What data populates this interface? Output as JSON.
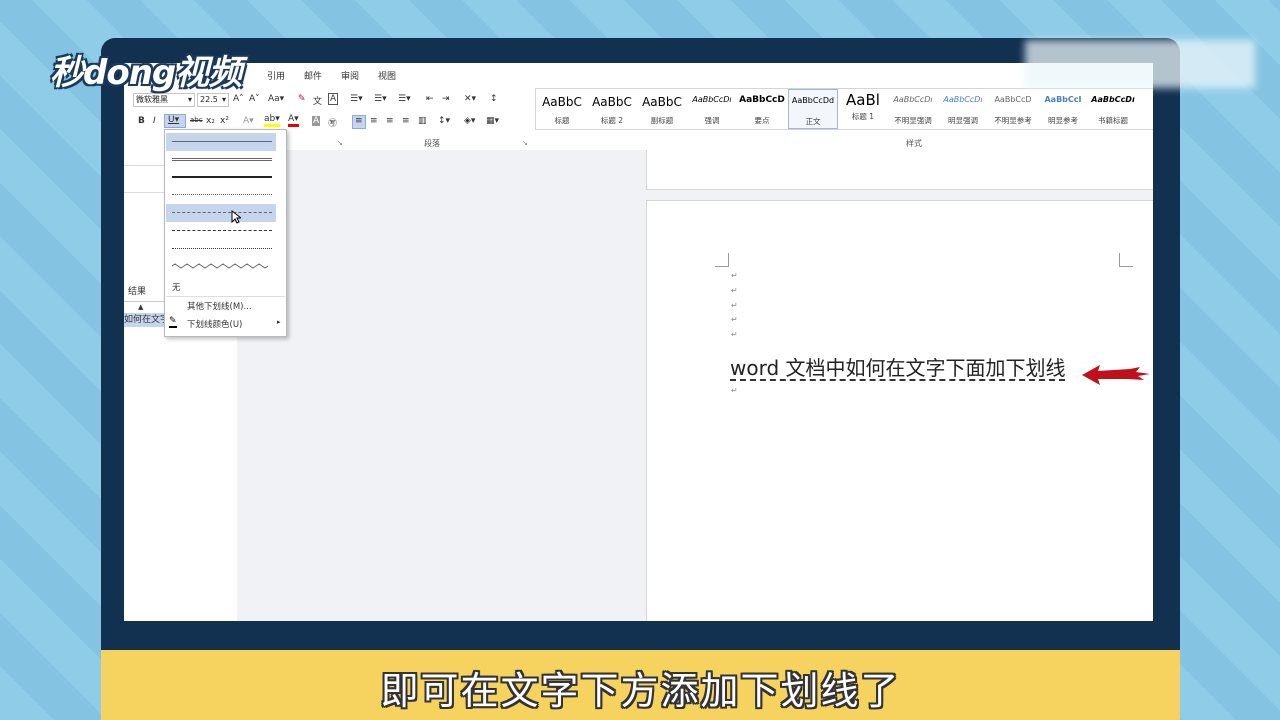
{
  "logo": "秒dong视频",
  "tabs": [
    "布局",
    "引用",
    "邮件",
    "审阅",
    "视图"
  ],
  "font": {
    "name": "微软雅黑",
    "size": "22.5"
  },
  "groups": {
    "paragraph": "段落",
    "styles": "样式"
  },
  "styles": [
    {
      "preview": "AaBbC",
      "name": "标题"
    },
    {
      "preview": "AaBbC",
      "name": "标题 2"
    },
    {
      "preview": "AaBbC",
      "name": "副标题"
    },
    {
      "preview": "AaBbCcDı",
      "name": "强调"
    },
    {
      "preview": "AaBbCcD",
      "name": "要点"
    },
    {
      "preview": "AaBbCcDd",
      "name": "正文"
    },
    {
      "preview": "AaBl",
      "name": "标题 1"
    },
    {
      "preview": "AaBbCcDı",
      "name": "不明显强调"
    },
    {
      "preview": "AaBbCcDı",
      "name": "明显强调"
    },
    {
      "preview": "AaBbCcD",
      "name": "不明显参考"
    },
    {
      "preview": "AaBbCcI",
      "name": "明显参考"
    },
    {
      "preview": "AaBbCcDı",
      "name": "书籍标题"
    }
  ],
  "nav": {
    "results": "结果",
    "item": "如何在文字"
  },
  "menu": {
    "none": "无",
    "more": "其他下划线(M)...",
    "color": "下划线颜色(U)"
  },
  "doc": {
    "text": "word 文档中如何在文字下面加下划线"
  },
  "caption": "即可在文字下方添加下划线了",
  "colors": {
    "frame": "#123050",
    "caption": "#f6d35e",
    "arrow": "#c0101c",
    "highlight": "#c5d5ee"
  }
}
